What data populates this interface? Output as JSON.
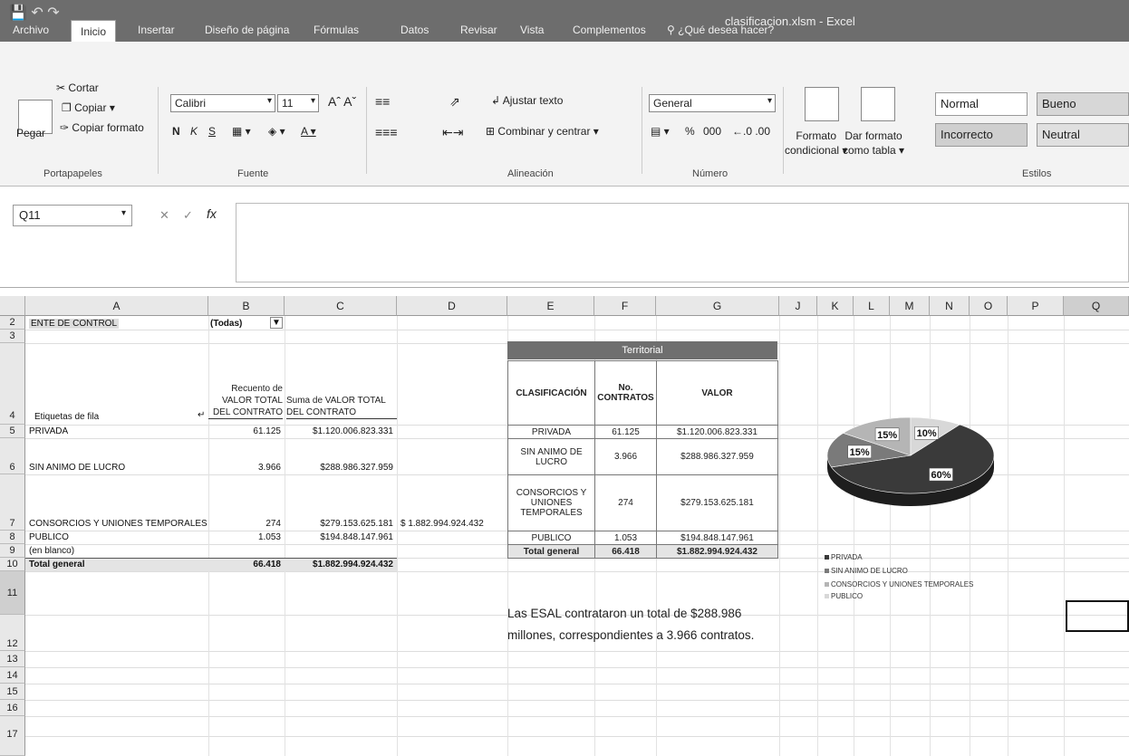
{
  "window": {
    "title": "clasificacion.xlsm - Excel"
  },
  "menu": {
    "tabs": [
      "Archivo",
      "Inicio",
      "Insertar",
      "Diseño de página",
      "Fórmulas",
      "Datos",
      "Revisar",
      "Vista",
      "Complementos"
    ],
    "search": "¿Qué desea hacer?"
  },
  "ribbon": {
    "portapapeles": {
      "cortar": "Cortar",
      "copiar": "Copiar",
      "pegar": "Pegar",
      "copiar_formato": "Copiar formato",
      "label": "Portapapeles"
    },
    "fuente": {
      "font_name": "Calibri",
      "font_size": "11",
      "bold": "N",
      "italic": "K",
      "underline": "S",
      "label": "Fuente"
    },
    "alineacion": {
      "ajustar_texto": "Ajustar texto",
      "combinar": "Combinar y centrar",
      "label": "Alineación"
    },
    "numero": {
      "format": "General",
      "percent": "%",
      "thousands": "000",
      "label": "Número"
    },
    "estilos": {
      "formato_condicional": [
        "Formato",
        "condicional"
      ],
      "dar_formato": [
        "Dar formato",
        "como tabla"
      ],
      "styles": [
        "Normal",
        "Bueno",
        "Incorrecto",
        "Neutral"
      ],
      "label": "Estilos"
    }
  },
  "formula_bar": {
    "name_box": "Q11",
    "fx": "fx",
    "formula": ""
  },
  "columns": [
    "A",
    "B",
    "C",
    "D",
    "E",
    "F",
    "G",
    "J",
    "K",
    "L",
    "M",
    "N",
    "O",
    "P",
    "Q"
  ],
  "rows": [
    "2",
    "3",
    "4",
    "5",
    "6",
    "7",
    "8",
    "9",
    "10",
    "11",
    "12",
    "13",
    "14",
    "15",
    "16",
    "17"
  ],
  "pivot": {
    "filter_label": "ENTE DE CONTROL",
    "filter_value": "(Todas)",
    "row_labels_header": "Etiquetas de fila",
    "col_b_header": [
      "Recuento de",
      "VALOR TOTAL",
      "DEL CONTRATO"
    ],
    "col_c_header": [
      "Suma de VALOR TOTAL",
      "DEL CONTRATO"
    ],
    "rows": [
      {
        "label": "PRIVADA",
        "count": "61.125",
        "sum": "$1.120.006.823.331"
      },
      {
        "label": "SIN ANIMO DE LUCRO",
        "count": "3.966",
        "sum": "$288.986.327.959"
      },
      {
        "label": "CONSORCIOS Y UNIONES TEMPORALES",
        "count": "274",
        "sum": "$279.153.625.181"
      },
      {
        "label": "PUBLICO",
        "count": "1.053",
        "sum": "$194.848.147.961"
      },
      {
        "label": "(en blanco)",
        "count": "",
        "sum": ""
      },
      {
        "label": "Total general",
        "count": "66.418",
        "sum": "$1.882.994.924.432"
      }
    ]
  },
  "d7_value": "$ 1.882.994.924.432",
  "summary_table": {
    "title": "Territorial",
    "headers": [
      "CLASIFICACIÓN",
      "No. CONTRATOS",
      "VALOR"
    ],
    "rows": [
      [
        "PRIVADA",
        "61.125",
        "$1.120.006.823.331"
      ],
      [
        "SIN ANIMO DE LUCRO",
        "3.966",
        "$288.986.327.959"
      ],
      [
        "CONSORCIOS Y UNIONES TEMPORALES",
        "274",
        "$279.153.625.181"
      ],
      [
        "PUBLICO",
        "1.053",
        "$194.848.147.961"
      ],
      [
        "Total general",
        "66.418",
        "$1.882.994.924.432"
      ]
    ]
  },
  "comment": "Las ESAL contrataron un total de $288.986 millones, correspondientes a 3.966 contratos.",
  "chart_data": {
    "type": "pie",
    "categories": [
      "PRIVADA",
      "SIN ANIMO DE LUCRO",
      "CONSORCIOS Y UNIONES TEMPORALES",
      "PUBLICO"
    ],
    "values": [
      60,
      15,
      15,
      10
    ],
    "data_labels": [
      "60%",
      "15%",
      "15%",
      "10%"
    ],
    "colors": [
      "#3a3a3a",
      "#7a7a7a",
      "#b5b5b5",
      "#d8d8d8"
    ],
    "legend": "bottom"
  }
}
